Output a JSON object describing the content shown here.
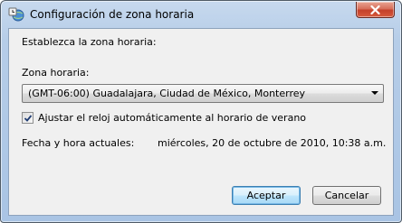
{
  "window": {
    "title": "Configuración de zona horaria",
    "close_label": "Cerrar"
  },
  "intro": {
    "text": "Establezca la zona horaria:"
  },
  "timezone": {
    "label": "Zona horaria:",
    "selected": "(GMT-06:00) Guadalajara, Ciudad de México, Monterrey"
  },
  "dst": {
    "label": "Ajustar el reloj automáticamente al horario de verano",
    "checked": true
  },
  "current": {
    "label": "Fecha y hora actuales:",
    "value": "miércoles, 20 de octubre de 2010, 10:38 a.m."
  },
  "buttons": {
    "ok": "Aceptar",
    "cancel": "Cancelar"
  },
  "icons": {
    "title": "clock-globe-icon",
    "close": "close-icon",
    "dropdown": "chevron-down-icon",
    "check": "checkmark-icon"
  }
}
